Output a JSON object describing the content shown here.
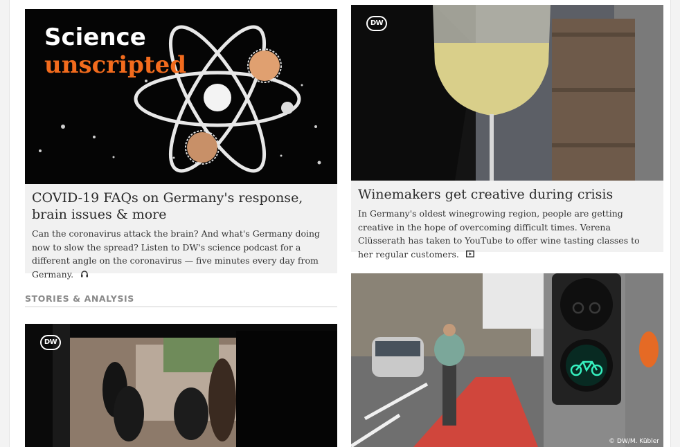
{
  "cards": {
    "science": {
      "headline": "COVID-19 FAQs on Germany's response, brain issues & more",
      "teaser": "Can the coronavirus attack the brain? And what's Germany doing now to slow the spread? Listen to DW's science podcast for a different angle on the coronavirus — five minutes every day from Germany.",
      "icon": "headphones-icon",
      "image_title_line1": "Science",
      "image_title_line2": "unscripted"
    },
    "wine": {
      "headline": "Winemakers get creative during crisis",
      "teaser": "In Germany's oldest winegrowing region, people are getting creative in the hope of overcoming difficult times. Verena Clüsserath has taken to YouTube to offer wine tasting classes to her regular customers.",
      "icon": "video-icon",
      "logo": "DW"
    },
    "story1": {
      "logo": "DW"
    },
    "bike": {
      "copyright": "© DW/M. Kübler"
    }
  },
  "section": {
    "heading": "STORIES & ANALYSIS"
  },
  "colors": {
    "accent_orange": "#f26b1d",
    "textbox_bg": "#f1f1f1",
    "heading_gray": "#8a8a8a"
  }
}
